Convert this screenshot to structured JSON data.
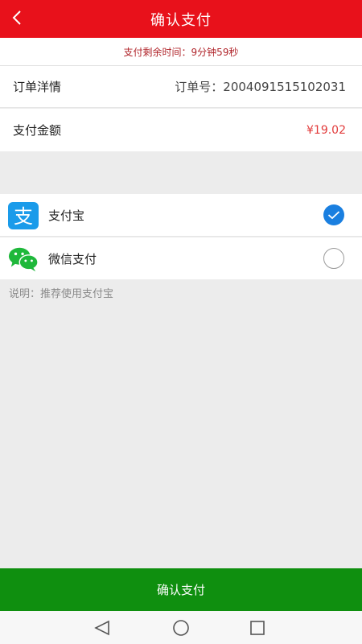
{
  "header": {
    "title": "确认支付",
    "back_icon": "chevron-left-icon"
  },
  "countdown": {
    "text": "支付剩余时间：9分钟59秒"
  },
  "order": {
    "label": "订单洋情",
    "number_text": "订单号：2004091515102031"
  },
  "amount": {
    "label": "支付金额",
    "value": "¥19.02"
  },
  "payment_methods": [
    {
      "label": "支付宝",
      "icon": "alipay-icon",
      "selected": true
    },
    {
      "label": "微信支付",
      "icon": "wechat-icon",
      "selected": false
    }
  ],
  "note": "说明：推荐使用支付宝",
  "confirm_button": {
    "label": "确认支付"
  },
  "colors": {
    "header": "#e8111b",
    "confirm": "#0f8f0f",
    "amount": "#e23b3b",
    "radio_selected": "#1a7fe0"
  },
  "system_nav": {
    "back": "triangle-back-icon",
    "home": "circle-home-icon",
    "recents": "square-recents-icon"
  }
}
